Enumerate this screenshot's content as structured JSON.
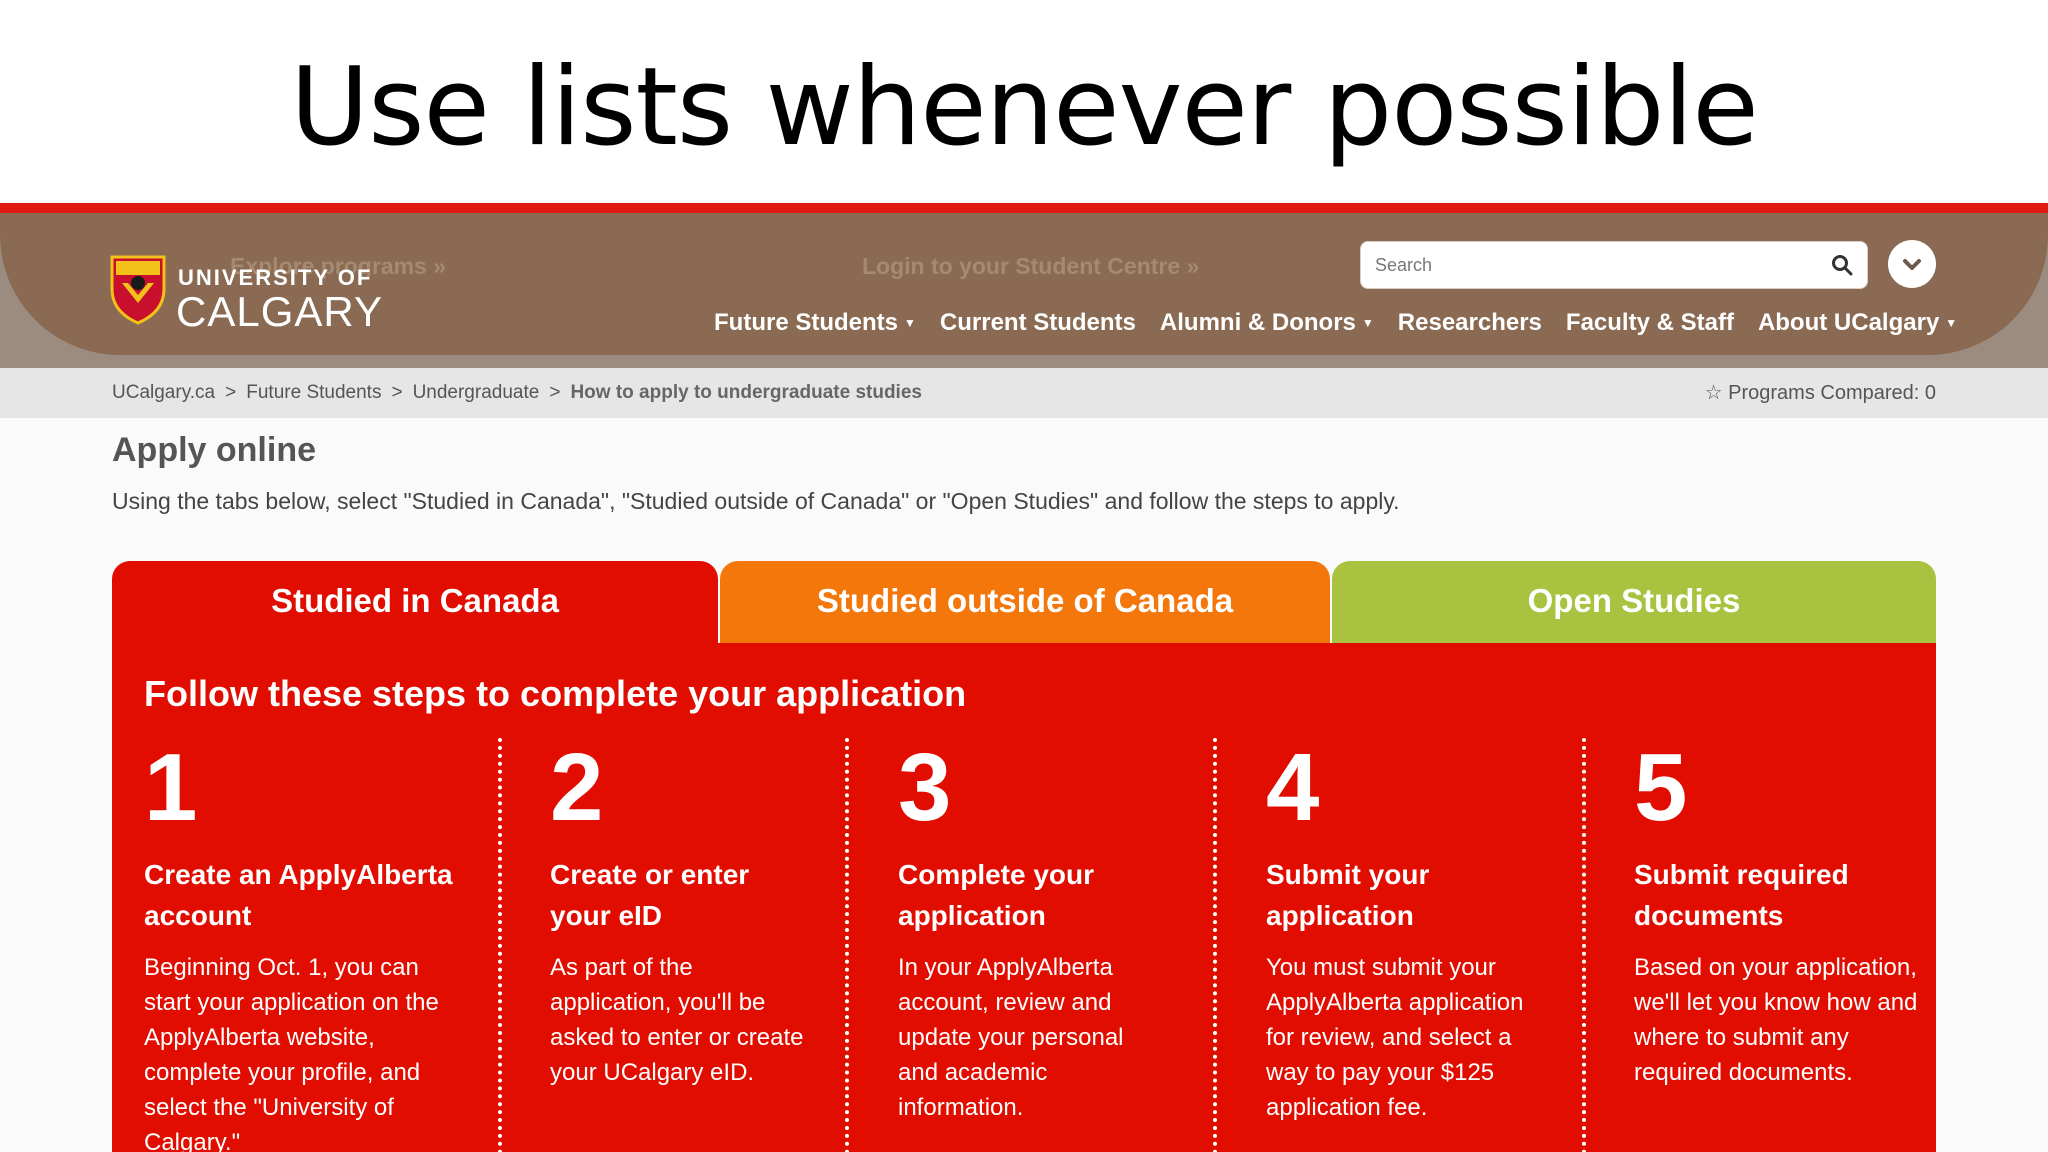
{
  "slide": {
    "title": "Use lists whenever possible"
  },
  "header": {
    "logo_line1": "UNIVERSITY OF",
    "logo_line2": "CALGARY",
    "ghost_links": [
      "Explore programs »",
      "Login to your Student Centre »"
    ],
    "search_placeholder": "Search",
    "nav": [
      {
        "label": "Future Students",
        "caret": true
      },
      {
        "label": "Current Students",
        "caret": false
      },
      {
        "label": "Alumni & Donors",
        "caret": true
      },
      {
        "label": "Researchers",
        "caret": false
      },
      {
        "label": "Faculty & Staff",
        "caret": false
      },
      {
        "label": "About UCalgary",
        "caret": true
      }
    ]
  },
  "breadcrumb": {
    "items": [
      "UCalgary.ca",
      "Future Students",
      "Undergraduate"
    ],
    "separator": ">",
    "current": "How to apply to undergraduate studies",
    "compare": "☆ Programs Compared: 0"
  },
  "main": {
    "title": "Apply online",
    "description": "Using the tabs below, select \"Studied in Canada\", \"Studied outside of Canada\" or \"Open Studies\" and follow the steps to apply.",
    "tabs": [
      {
        "label": "Studied in Canada",
        "color": "#e00d00"
      },
      {
        "label": "Studied outside of Canada",
        "color": "#f4770b"
      },
      {
        "label": "Open Studies",
        "color": "#a9c23f"
      }
    ],
    "panel_title": "Follow these steps to complete your application",
    "steps": [
      {
        "number": "1",
        "heading": "Create an ApplyAlberta account",
        "body": "Beginning Oct. 1, you can start your application on the ApplyAlberta website, complete your profile, and select the \"University of Calgary.\""
      },
      {
        "number": "2",
        "heading": "Create or enter your eID",
        "body": "As part of the application, you'll be asked to enter or create your UCalgary eID."
      },
      {
        "number": "3",
        "heading": "Complete your application",
        "body": "In your ApplyAlberta account, review and update your personal and academic information."
      },
      {
        "number": "4",
        "heading": "Submit your application",
        "body": "You must submit your ApplyAlberta application for review, and select a way to pay your $125 application fee."
      },
      {
        "number": "5",
        "heading": "Submit required documents",
        "body": "Based on your application, we'll let you know how and where to submit any required documents."
      }
    ]
  },
  "colors": {
    "accent_red": "#e01b12",
    "header_brown": "#8a6a52"
  }
}
